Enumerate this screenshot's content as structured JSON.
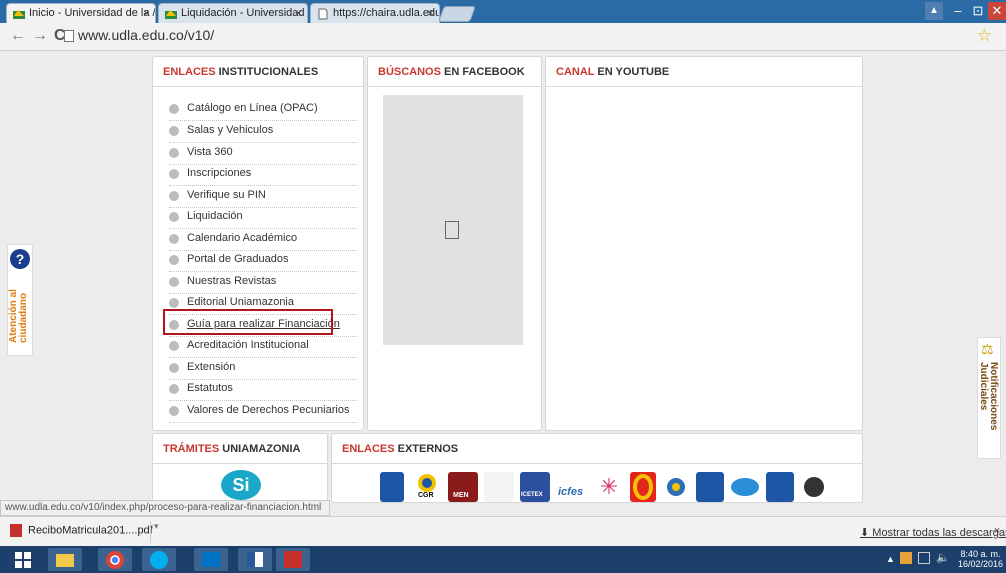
{
  "browser": {
    "tabs": [
      {
        "label": "Inicio - Universidad de la /",
        "active": true
      },
      {
        "label": "Liquidación - Universidad",
        "active": false
      },
      {
        "label": "https://chaira.udla.edu.co/",
        "active": false
      }
    ],
    "url": "www.udla.edu.co/v10/",
    "nav": {
      "back": "←",
      "forward": "→",
      "reload": "C"
    },
    "window_controls": {
      "user": "▲",
      "minimize": "–",
      "restore": "⊡",
      "close": "✕"
    }
  },
  "panels": {
    "institucionales": {
      "title_highlight": "ENLACES",
      "title_rest": " INSTITUCIONALES",
      "items": [
        "Catálogo en Línea (OPAC)",
        "Salas y Vehiculos",
        "Vista 360",
        "Inscripciones",
        "Verifique su PIN",
        "Liquidación",
        "Calendario Académico",
        "Portal de Graduados",
        "Nuestras Revistas",
        "Editorial Uniamazonia",
        "Guía para realizar Financiación",
        "Acreditación Institucional",
        "Extensión",
        "Estatutos",
        "Valores de Derechos Pecuniarios"
      ]
    },
    "facebook": {
      "title_highlight": "BÚSCANOS",
      "title_rest": " EN FACEBOOK"
    },
    "youtube": {
      "title_highlight": "CANAL",
      "title_rest": " EN YOUTUBE"
    },
    "tramites": {
      "title_highlight": "TRÁMITES",
      "title_rest": " UNIAMAZONIA",
      "logo_text": "Si"
    },
    "externos": {
      "title_highlight": "ENLACES",
      "title_rest": " EXTERNOS",
      "logos": [
        "CGR",
        "MEN",
        "ICETEX",
        "icfes"
      ]
    }
  },
  "side_tabs": {
    "left": {
      "line1": "Atención al",
      "line2": "ciudadano",
      "icon": "?"
    },
    "right": {
      "line1": "Notificaciones",
      "line2": "Judiciales"
    }
  },
  "status_url": "www.udla.edu.co/v10/index.php/proceso-para-realizar-financiacion.html",
  "downloads": {
    "file": "ReciboMatricula201....pdf",
    "show_all": "Mostrar todas las descargas...",
    "close": "×"
  },
  "taskbar": {
    "time": "8:40 a. m.",
    "date": "16/02/2016"
  },
  "colors": {
    "accent_red": "#c8382e",
    "highlight_box": "#b5131b",
    "tabbar": "#2a6aa5",
    "taskbar": "#1c3f6c"
  }
}
